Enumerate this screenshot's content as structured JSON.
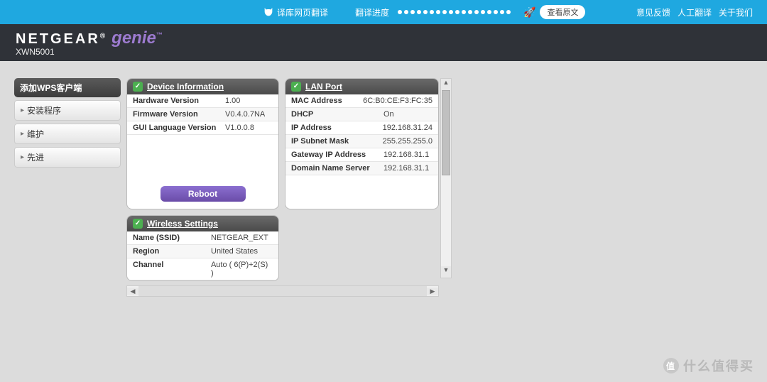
{
  "topbar": {
    "translate_tool": "译库网页翻译",
    "progress_label": "翻译进度",
    "view_original": "查看原文",
    "links": [
      "意见反馈",
      "人工翻译",
      "关于我们"
    ]
  },
  "header": {
    "brand": "NETGEAR",
    "sub_brand": "genie",
    "model": "XWN5001"
  },
  "sidebar": {
    "header": "添加WPS客户端",
    "items": [
      "安装程序",
      "维护",
      "先进"
    ]
  },
  "panels": {
    "device_info": {
      "title": "Device Information",
      "rows": [
        {
          "k": "Hardware Version",
          "v": "1.00"
        },
        {
          "k": "Firmware Version",
          "v": "V0.4.0.7NA"
        },
        {
          "k": "GUI Language Version",
          "v": "V1.0.0.8"
        }
      ],
      "reboot_label": "Reboot"
    },
    "lan_port": {
      "title": "LAN Port",
      "rows": [
        {
          "k": "MAC Address",
          "v": "6C:B0:CE:F3:FC:35"
        },
        {
          "k": "DHCP",
          "v": "On"
        },
        {
          "k": "IP Address",
          "v": "192.168.31.24"
        },
        {
          "k": "IP Subnet Mask",
          "v": "255.255.255.0"
        },
        {
          "k": "Gateway IP Address",
          "v": "192.168.31.1"
        },
        {
          "k": "Domain Name Server",
          "v": "192.168.31.1"
        }
      ]
    },
    "wireless": {
      "title": "Wireless Settings",
      "rows": [
        {
          "k": "Name (SSID)",
          "v": "NETGEAR_EXT"
        },
        {
          "k": "Region",
          "v": "United States"
        },
        {
          "k": "Channel",
          "v": "Auto ( 6(P)+2(S) )"
        }
      ]
    }
  },
  "watermark": {
    "char": "值",
    "text": "什么值得买"
  }
}
